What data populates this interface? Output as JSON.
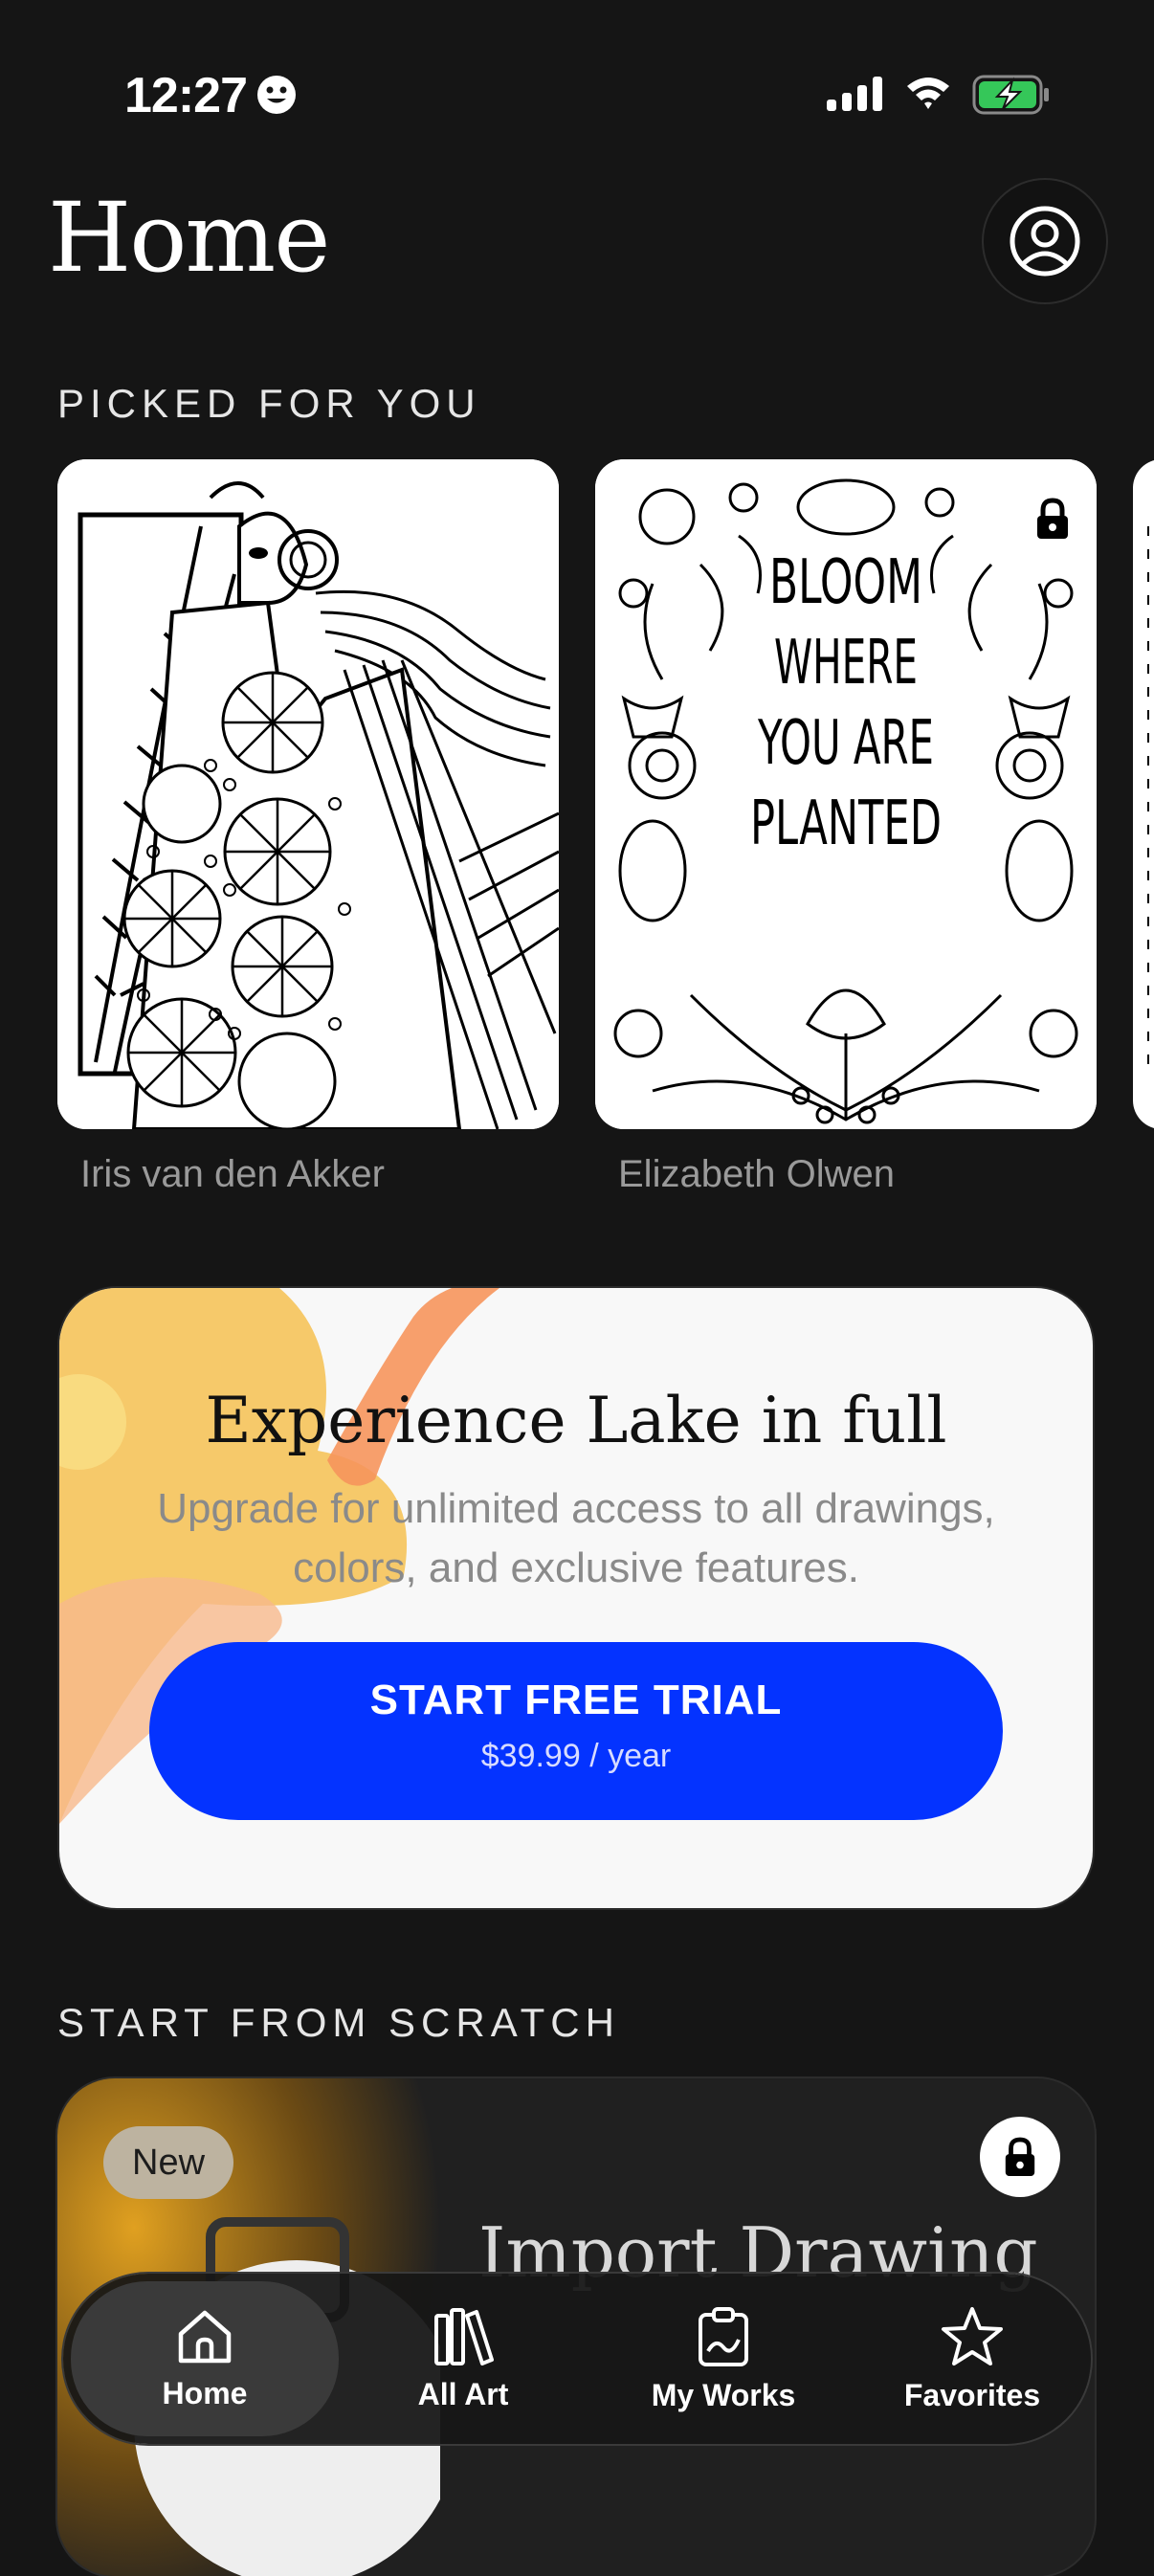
{
  "status_bar": {
    "time": "12:27"
  },
  "header": {
    "title": "Home"
  },
  "picked_section": {
    "label": "PICKED FOR YOU",
    "cards": [
      {
        "artist": "Iris van den Akker",
        "locked": false
      },
      {
        "artist": "Elizabeth Olwen",
        "locked": true,
        "art_text": [
          "BLOOM",
          "WHERE",
          "YOU ARE",
          "PLANTED"
        ]
      }
    ]
  },
  "upgrade": {
    "title": "Experience Lake in full",
    "subtitle": "Upgrade for unlimited access to all drawings, colors, and exclusive features.",
    "button_label": "START FREE TRIAL",
    "price": "$39.99 / year",
    "button_color": "#0433ff"
  },
  "scratch_section": {
    "label": "START FROM SCRATCH",
    "import_card": {
      "badge": "New",
      "title": "Import Drawing",
      "locked": true
    }
  },
  "tabbar": {
    "tabs": [
      {
        "label": "Home",
        "icon": "house-icon",
        "active": true
      },
      {
        "label": "All Art",
        "icon": "books-icon",
        "active": false
      },
      {
        "label": "My Works",
        "icon": "clipboard-icon",
        "active": false
      },
      {
        "label": "Favorites",
        "icon": "star-icon",
        "active": false
      }
    ]
  }
}
